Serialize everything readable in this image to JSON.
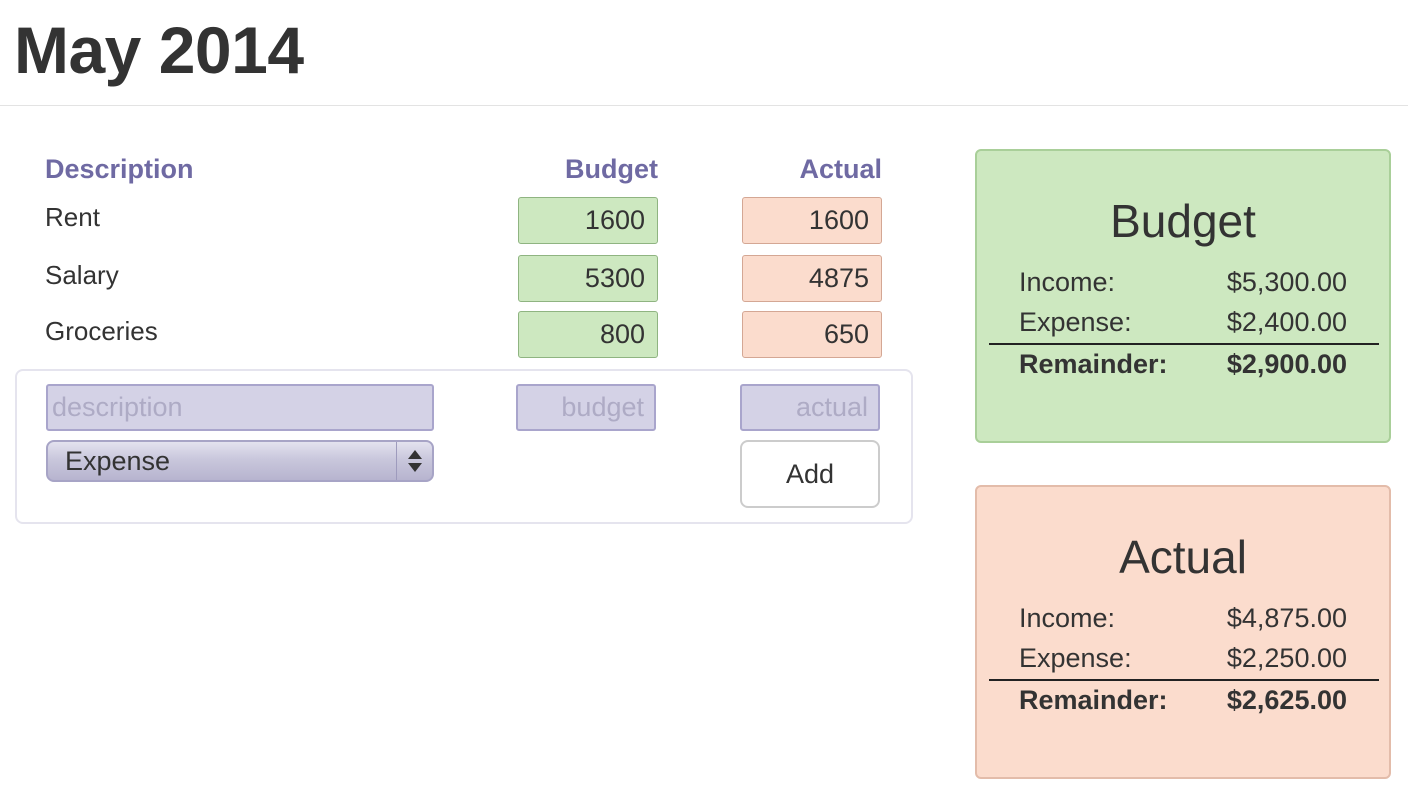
{
  "page": {
    "title": "May 2014"
  },
  "table": {
    "headers": {
      "description": "Description",
      "budget": "Budget",
      "actual": "Actual"
    },
    "rows": [
      {
        "description": "Rent",
        "budget": "1600",
        "actual": "1600"
      },
      {
        "description": "Salary",
        "budget": "5300",
        "actual": "4875"
      },
      {
        "description": "Groceries",
        "budget": "800",
        "actual": "650"
      }
    ]
  },
  "add_form": {
    "description_placeholder": "description",
    "budget_placeholder": "budget",
    "actual_placeholder": "actual",
    "type_selected": "Expense",
    "add_label": "Add"
  },
  "summary": {
    "budget": {
      "title": "Budget",
      "income_label": "Income:",
      "income_value": "$5,300.00",
      "expense_label": "Expense:",
      "expense_value": "$2,400.00",
      "remainder_label": "Remainder:",
      "remainder_value": "$2,900.00"
    },
    "actual": {
      "title": "Actual",
      "income_label": "Income:",
      "income_value": "$4,875.00",
      "expense_label": "Expense:",
      "expense_value": "$2,250.00",
      "remainder_label": "Remainder:",
      "remainder_value": "$2,625.00"
    }
  },
  "colors": {
    "header_text": "#6f6aa3",
    "budget_green": "#cde8c0",
    "actual_peach": "#fbdccd",
    "input_lavender": "#d4d2e6"
  },
  "icons": {
    "select_arrows": "updown-chevron-icon"
  }
}
